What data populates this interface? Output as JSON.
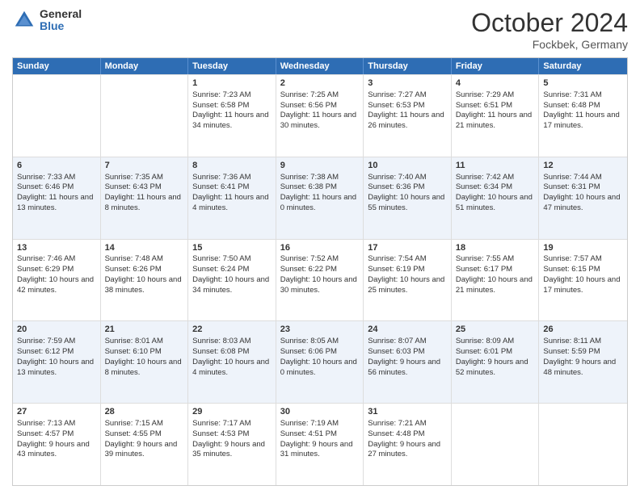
{
  "header": {
    "logo_general": "General",
    "logo_blue": "Blue",
    "month_title": "October 2024",
    "location": "Fockbek, Germany"
  },
  "days_of_week": [
    "Sunday",
    "Monday",
    "Tuesday",
    "Wednesday",
    "Thursday",
    "Friday",
    "Saturday"
  ],
  "rows": [
    {
      "bg": "odd",
      "cells": [
        {
          "day": "",
          "empty": true
        },
        {
          "day": "",
          "empty": true
        },
        {
          "day": "1",
          "sunrise": "Sunrise: 7:23 AM",
          "sunset": "Sunset: 6:58 PM",
          "daylight": "Daylight: 11 hours and 34 minutes."
        },
        {
          "day": "2",
          "sunrise": "Sunrise: 7:25 AM",
          "sunset": "Sunset: 6:56 PM",
          "daylight": "Daylight: 11 hours and 30 minutes."
        },
        {
          "day": "3",
          "sunrise": "Sunrise: 7:27 AM",
          "sunset": "Sunset: 6:53 PM",
          "daylight": "Daylight: 11 hours and 26 minutes."
        },
        {
          "day": "4",
          "sunrise": "Sunrise: 7:29 AM",
          "sunset": "Sunset: 6:51 PM",
          "daylight": "Daylight: 11 hours and 21 minutes."
        },
        {
          "day": "5",
          "sunrise": "Sunrise: 7:31 AM",
          "sunset": "Sunset: 6:48 PM",
          "daylight": "Daylight: 11 hours and 17 minutes."
        }
      ]
    },
    {
      "bg": "even",
      "cells": [
        {
          "day": "6",
          "sunrise": "Sunrise: 7:33 AM",
          "sunset": "Sunset: 6:46 PM",
          "daylight": "Daylight: 11 hours and 13 minutes."
        },
        {
          "day": "7",
          "sunrise": "Sunrise: 7:35 AM",
          "sunset": "Sunset: 6:43 PM",
          "daylight": "Daylight: 11 hours and 8 minutes."
        },
        {
          "day": "8",
          "sunrise": "Sunrise: 7:36 AM",
          "sunset": "Sunset: 6:41 PM",
          "daylight": "Daylight: 11 hours and 4 minutes."
        },
        {
          "day": "9",
          "sunrise": "Sunrise: 7:38 AM",
          "sunset": "Sunset: 6:38 PM",
          "daylight": "Daylight: 11 hours and 0 minutes."
        },
        {
          "day": "10",
          "sunrise": "Sunrise: 7:40 AM",
          "sunset": "Sunset: 6:36 PM",
          "daylight": "Daylight: 10 hours and 55 minutes."
        },
        {
          "day": "11",
          "sunrise": "Sunrise: 7:42 AM",
          "sunset": "Sunset: 6:34 PM",
          "daylight": "Daylight: 10 hours and 51 minutes."
        },
        {
          "day": "12",
          "sunrise": "Sunrise: 7:44 AM",
          "sunset": "Sunset: 6:31 PM",
          "daylight": "Daylight: 10 hours and 47 minutes."
        }
      ]
    },
    {
      "bg": "odd",
      "cells": [
        {
          "day": "13",
          "sunrise": "Sunrise: 7:46 AM",
          "sunset": "Sunset: 6:29 PM",
          "daylight": "Daylight: 10 hours and 42 minutes."
        },
        {
          "day": "14",
          "sunrise": "Sunrise: 7:48 AM",
          "sunset": "Sunset: 6:26 PM",
          "daylight": "Daylight: 10 hours and 38 minutes."
        },
        {
          "day": "15",
          "sunrise": "Sunrise: 7:50 AM",
          "sunset": "Sunset: 6:24 PM",
          "daylight": "Daylight: 10 hours and 34 minutes."
        },
        {
          "day": "16",
          "sunrise": "Sunrise: 7:52 AM",
          "sunset": "Sunset: 6:22 PM",
          "daylight": "Daylight: 10 hours and 30 minutes."
        },
        {
          "day": "17",
          "sunrise": "Sunrise: 7:54 AM",
          "sunset": "Sunset: 6:19 PM",
          "daylight": "Daylight: 10 hours and 25 minutes."
        },
        {
          "day": "18",
          "sunrise": "Sunrise: 7:55 AM",
          "sunset": "Sunset: 6:17 PM",
          "daylight": "Daylight: 10 hours and 21 minutes."
        },
        {
          "day": "19",
          "sunrise": "Sunrise: 7:57 AM",
          "sunset": "Sunset: 6:15 PM",
          "daylight": "Daylight: 10 hours and 17 minutes."
        }
      ]
    },
    {
      "bg": "even",
      "cells": [
        {
          "day": "20",
          "sunrise": "Sunrise: 7:59 AM",
          "sunset": "Sunset: 6:12 PM",
          "daylight": "Daylight: 10 hours and 13 minutes."
        },
        {
          "day": "21",
          "sunrise": "Sunrise: 8:01 AM",
          "sunset": "Sunset: 6:10 PM",
          "daylight": "Daylight: 10 hours and 8 minutes."
        },
        {
          "day": "22",
          "sunrise": "Sunrise: 8:03 AM",
          "sunset": "Sunset: 6:08 PM",
          "daylight": "Daylight: 10 hours and 4 minutes."
        },
        {
          "day": "23",
          "sunrise": "Sunrise: 8:05 AM",
          "sunset": "Sunset: 6:06 PM",
          "daylight": "Daylight: 10 hours and 0 minutes."
        },
        {
          "day": "24",
          "sunrise": "Sunrise: 8:07 AM",
          "sunset": "Sunset: 6:03 PM",
          "daylight": "Daylight: 9 hours and 56 minutes."
        },
        {
          "day": "25",
          "sunrise": "Sunrise: 8:09 AM",
          "sunset": "Sunset: 6:01 PM",
          "daylight": "Daylight: 9 hours and 52 minutes."
        },
        {
          "day": "26",
          "sunrise": "Sunrise: 8:11 AM",
          "sunset": "Sunset: 5:59 PM",
          "daylight": "Daylight: 9 hours and 48 minutes."
        }
      ]
    },
    {
      "bg": "odd",
      "cells": [
        {
          "day": "27",
          "sunrise": "Sunrise: 7:13 AM",
          "sunset": "Sunset: 4:57 PM",
          "daylight": "Daylight: 9 hours and 43 minutes."
        },
        {
          "day": "28",
          "sunrise": "Sunrise: 7:15 AM",
          "sunset": "Sunset: 4:55 PM",
          "daylight": "Daylight: 9 hours and 39 minutes."
        },
        {
          "day": "29",
          "sunrise": "Sunrise: 7:17 AM",
          "sunset": "Sunset: 4:53 PM",
          "daylight": "Daylight: 9 hours and 35 minutes."
        },
        {
          "day": "30",
          "sunrise": "Sunrise: 7:19 AM",
          "sunset": "Sunset: 4:51 PM",
          "daylight": "Daylight: 9 hours and 31 minutes."
        },
        {
          "day": "31",
          "sunrise": "Sunrise: 7:21 AM",
          "sunset": "Sunset: 4:48 PM",
          "daylight": "Daylight: 9 hours and 27 minutes."
        },
        {
          "day": "",
          "empty": true
        },
        {
          "day": "",
          "empty": true
        }
      ]
    }
  ]
}
